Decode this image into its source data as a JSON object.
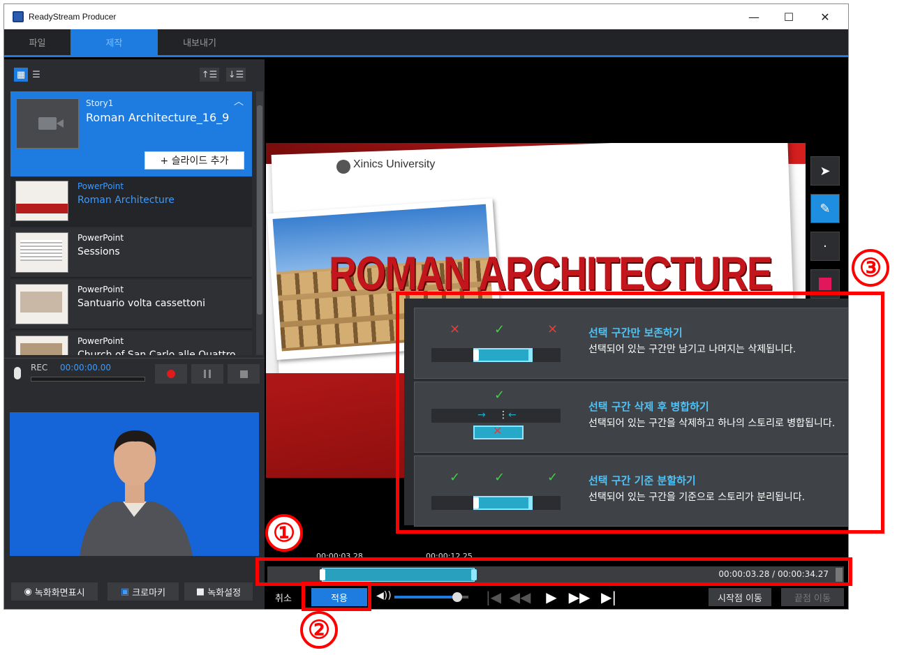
{
  "window": {
    "title": "ReadyStream Producer",
    "minimize": "—",
    "maximize": "☐",
    "close": "✕"
  },
  "menu": {
    "tabs": [
      "파일",
      "제작",
      "내보내기"
    ],
    "active": "제작"
  },
  "story": {
    "label": "Story1",
    "title": "Roman Architecture_16_9",
    "add_slide_label": "+ 슬라이드 추가"
  },
  "slides": [
    {
      "type": "PowerPoint",
      "name": "Roman Architecture",
      "selected": true
    },
    {
      "type": "PowerPoint",
      "name": "Sessions"
    },
    {
      "type": "PowerPoint",
      "name": "Santuario volta cassettoni"
    },
    {
      "type": "PowerPoint",
      "name": "Church of San Carlo alle Quattro"
    }
  ],
  "recorder": {
    "label": "REC",
    "time": "00:00:00.00"
  },
  "webcam_buttons": {
    "show_screen": "녹화화면표시",
    "chroma_key": "크로마키",
    "settings": "녹화설정"
  },
  "preview": {
    "university": "Xinics University",
    "slide_title": "ROMAN ARCHITECTURE"
  },
  "edit_options": [
    {
      "title": "선택 구간만 보존하기",
      "desc": "선택되어 있는 구간만 남기고 나머지는 삭제됩니다."
    },
    {
      "title": "선택 구간 삭제 후 병합하기",
      "desc": "선택되어 있는 구간을 삭제하고 하나의 스토리로 병합됩니다."
    },
    {
      "title": "선택 구간 기준 분할하기",
      "desc": "선택되어 있는 구간을 기준으로 스토리가 분리됩니다."
    }
  ],
  "timeline": {
    "start_label": "00:00:03.28",
    "end_label": "00:00:12.25",
    "time_display": "00:00:03.28 / 00:00:34.27",
    "selection_start_fraction": 0.094,
    "selection_end_fraction": 0.359
  },
  "controls": {
    "cancel": "취소",
    "apply": "적용",
    "volume_fraction": 0.85,
    "move_start": "시작점 이동",
    "move_end": "끝점 이동"
  },
  "annotations": [
    "①",
    "②",
    "③"
  ],
  "colors": {
    "accent": "#1e7be0",
    "highlight": "#ff0000",
    "selection": "#2aa0bf"
  }
}
